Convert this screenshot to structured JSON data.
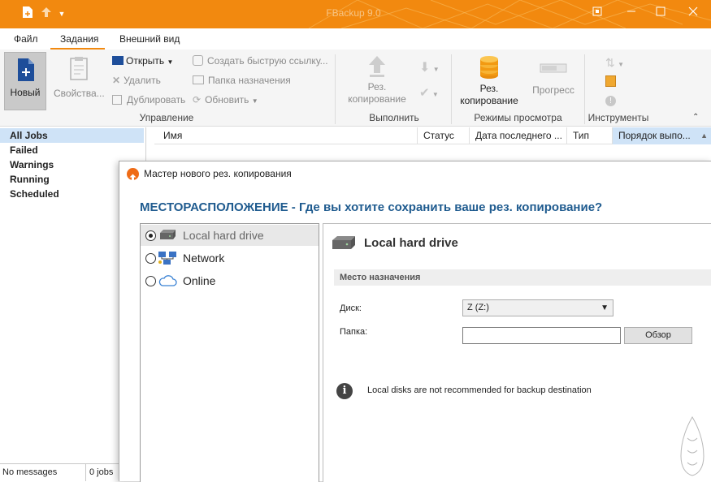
{
  "window": {
    "title": "FBackup 9.0",
    "icons": [
      "new-document-icon",
      "upload-arrow-icon",
      "chevron-down-icon",
      "restore-window-icon",
      "minimize-icon",
      "maximize-icon",
      "close-icon"
    ]
  },
  "menu": {
    "tabs": [
      {
        "label": "Файл"
      },
      {
        "label": "Задания"
      },
      {
        "label": "Внешний вид"
      }
    ],
    "active_tab": "Задания"
  },
  "ribbon": {
    "new_label": "Новый",
    "properties_label": "Свойства...",
    "open_label": "Открыть",
    "delete_label": "Удалить",
    "duplicate_label": "Дублировать",
    "shortcut_label": "Создать быструю ссылку...",
    "destination_folder_label": "Папка назначения",
    "refresh_label": "Обновить",
    "group_manage": "Управление",
    "backup_label": "Рез. копирование",
    "backup_line1": "Рез.",
    "backup_line2": "копирование",
    "group_run": "Выполнить",
    "backup2_line1": "Рез.",
    "backup2_line2": "копирование",
    "progress_label": "Прогресс",
    "group_view": "Режимы просмотра",
    "group_tools": "Инструменты"
  },
  "sidebar": {
    "items": [
      {
        "label": "All Jobs"
      },
      {
        "label": "Failed"
      },
      {
        "label": "Warnings"
      },
      {
        "label": "Running"
      },
      {
        "label": "Scheduled"
      }
    ],
    "selected": "All Jobs"
  },
  "columns": [
    {
      "label": "Имя"
    },
    {
      "label": "Статус"
    },
    {
      "label": "Дата последнего ..."
    },
    {
      "label": "Тип"
    },
    {
      "label": "Порядок выпо..."
    }
  ],
  "sort_indicator": "▲",
  "statusbar": {
    "messages": "No messages",
    "jobs": "0 jobs"
  },
  "dialog": {
    "title": "Мастер нового рез. копирования",
    "heading": "МЕСТОРАСПОЛОЖЕНИЕ - Где вы хотите сохранить ваше рез. копирование?",
    "options": [
      {
        "label": "Local hard drive",
        "selected": true,
        "icon": "hard-drive-icon"
      },
      {
        "label": "Network",
        "selected": false,
        "icon": "network-icon"
      },
      {
        "label": "Online",
        "selected": false,
        "icon": "cloud-icon"
      }
    ],
    "panel_title": "Local hard drive",
    "section_label": "Место назначения",
    "disk_label": "Диск:",
    "disk_value": "Z (Z:)",
    "folder_label": "Папка:",
    "folder_value": "",
    "browse_label": "Обзор",
    "info_text": "Local disks are not recommended for backup destination"
  },
  "colors": {
    "accent": "#f2890f",
    "selection": "#cfe3f7",
    "heading": "#1f5b8f"
  }
}
